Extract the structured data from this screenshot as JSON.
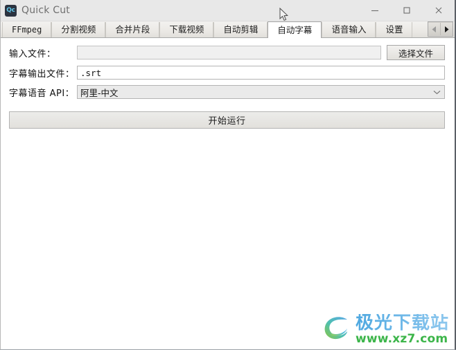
{
  "window": {
    "title": "Quick Cut",
    "app_icon_text": "Qc",
    "icon_name": "quickcut-app-icon",
    "controls": {
      "minimize": "minimize-icon",
      "maximize": "maximize-icon",
      "close": "close-icon"
    }
  },
  "tabs": {
    "items": [
      {
        "label": "FFmpeg",
        "active": false
      },
      {
        "label": "分割视频",
        "active": false
      },
      {
        "label": "合并片段",
        "active": false
      },
      {
        "label": "下载视频",
        "active": false
      },
      {
        "label": "自动剪辑",
        "active": false
      },
      {
        "label": "自动字幕",
        "active": true
      },
      {
        "label": "语音输入",
        "active": false
      },
      {
        "label": "设置",
        "active": false
      }
    ],
    "scroll_left": "◀",
    "scroll_right": "▶"
  },
  "form": {
    "rows": [
      {
        "label": "输入文件：",
        "value": "",
        "placeholder": "",
        "type": "text-muted"
      },
      {
        "label": "字幕输出文件：",
        "value": ".srt",
        "placeholder": "",
        "type": "text"
      },
      {
        "label": "字幕语音 API：",
        "value": "阿里-中文",
        "placeholder": "",
        "type": "combo"
      }
    ],
    "pick_file_button": "选择文件",
    "run_button": "开始运行"
  },
  "watermark": {
    "title": "极光下载站",
    "url": "www.xz7.com",
    "logo_name": "jiguang-swirl-logo"
  },
  "colors": {
    "titlebar": "#e8e8e8",
    "tabstrip": "#eceae6",
    "body": "#ffffff",
    "accent_icon": "#5fc4e8",
    "watermark_blue": "#5fb0e4",
    "watermark_green": "#3cb54a"
  }
}
